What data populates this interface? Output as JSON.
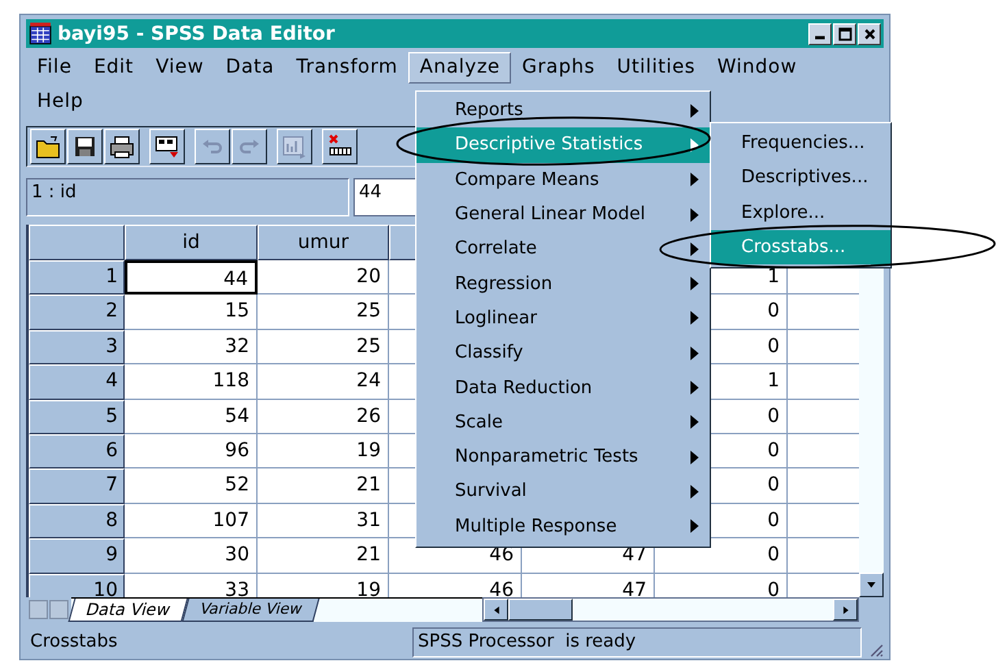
{
  "window": {
    "title": "bayi95 - SPSS Data Editor"
  },
  "menu_bar": [
    {
      "label": "File",
      "selected": false
    },
    {
      "label": "Edit",
      "selected": false
    },
    {
      "label": "View",
      "selected": false
    },
    {
      "label": "Data",
      "selected": false
    },
    {
      "label": "Transform",
      "selected": false
    },
    {
      "label": "Analyze",
      "selected": true
    },
    {
      "label": "Graphs",
      "selected": false
    },
    {
      "label": "Utilities",
      "selected": false
    },
    {
      "label": "Window",
      "selected": false
    },
    {
      "label": "Help",
      "selected": false
    }
  ],
  "cell_reference": {
    "name": "1 : id",
    "value": "44"
  },
  "table": {
    "columns": [
      "id",
      "umur"
    ],
    "rows": [
      {
        "row": "1",
        "cells": [
          "44",
          "20",
          null,
          null,
          "1"
        ]
      },
      {
        "row": "2",
        "cells": [
          "15",
          "25",
          null,
          null,
          "0"
        ]
      },
      {
        "row": "3",
        "cells": [
          "32",
          "25",
          null,
          null,
          "0"
        ]
      },
      {
        "row": "4",
        "cells": [
          "118",
          "24",
          null,
          null,
          "1"
        ]
      },
      {
        "row": "5",
        "cells": [
          "54",
          "26",
          null,
          null,
          "0"
        ]
      },
      {
        "row": "6",
        "cells": [
          "96",
          "19",
          null,
          null,
          "0"
        ]
      },
      {
        "row": "7",
        "cells": [
          "52",
          "21",
          null,
          null,
          "0"
        ]
      },
      {
        "row": "8",
        "cells": [
          "107",
          "31",
          null,
          null,
          "0"
        ]
      },
      {
        "row": "9",
        "cells": [
          "30",
          "21",
          "46",
          "47",
          "0"
        ]
      },
      {
        "row": "10",
        "cells": [
          "33",
          "19",
          "46",
          "47",
          "0"
        ]
      }
    ]
  },
  "sheet_tabs": [
    {
      "label": "Data View",
      "selected": true
    },
    {
      "label": "Variable View",
      "selected": false
    }
  ],
  "analyze_menu": [
    {
      "label": "Reports",
      "selected": false
    },
    {
      "label": "Descriptive Statistics",
      "selected": true
    },
    {
      "label": "Compare Means",
      "selected": false
    },
    {
      "label": "General Linear Model",
      "selected": false
    },
    {
      "label": "Correlate",
      "selected": false
    },
    {
      "label": "Regression",
      "selected": false
    },
    {
      "label": "Loglinear",
      "selected": false
    },
    {
      "label": "Classify",
      "selected": false
    },
    {
      "label": "Data Reduction",
      "selected": false
    },
    {
      "label": "Scale",
      "selected": false
    },
    {
      "label": "Nonparametric Tests",
      "selected": false
    },
    {
      "label": "Survival",
      "selected": false
    },
    {
      "label": "Multiple Response",
      "selected": false
    }
  ],
  "descriptive_submenu": [
    {
      "label": "Frequencies...",
      "selected": false
    },
    {
      "label": "Descriptives...",
      "selected": false
    },
    {
      "label": "Explore...",
      "selected": false
    },
    {
      "label": "Crosstabs...",
      "selected": true
    }
  ],
  "status_bar": {
    "message": "Crosstabs",
    "processor": "SPSS Processor  is ready"
  }
}
